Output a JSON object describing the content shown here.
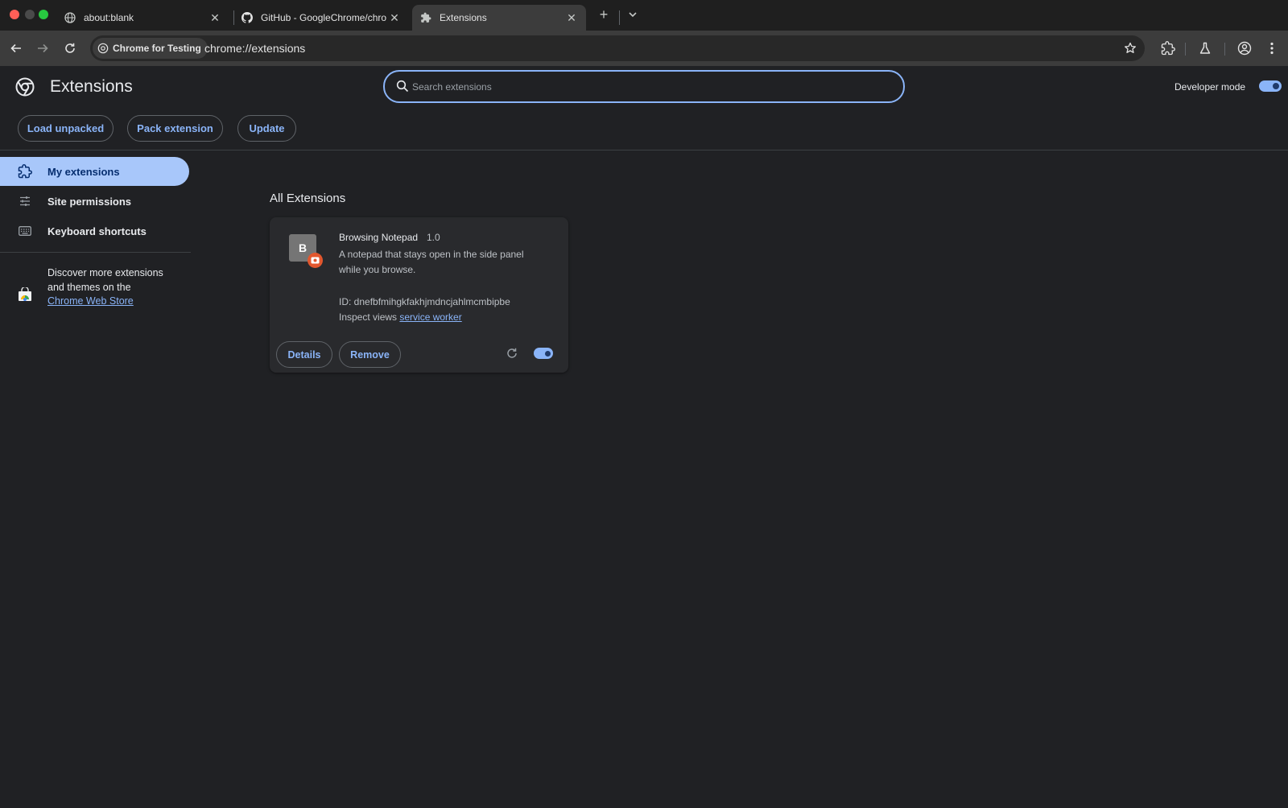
{
  "tabs": [
    {
      "title": "about:blank",
      "icon": "globe-icon",
      "active": false
    },
    {
      "title": "GitHub - GoogleChrome/chro",
      "icon": "github-icon",
      "active": false
    },
    {
      "title": "Extensions",
      "icon": "puzzle-icon",
      "active": true
    }
  ],
  "toolbar": {
    "chip_label": "Chrome for Testing",
    "url": "chrome://extensions"
  },
  "header": {
    "title": "Extensions",
    "search_placeholder": "Search extensions",
    "developer_mode_label": "Developer mode",
    "developer_mode_on": true
  },
  "actions": {
    "load_unpacked": "Load unpacked",
    "pack_extension": "Pack extension",
    "update": "Update"
  },
  "sidebar": {
    "items": [
      {
        "label": "My extensions",
        "icon": "puzzle-outline-icon",
        "active": true
      },
      {
        "label": "Site permissions",
        "icon": "sliders-icon",
        "active": false
      },
      {
        "label": "Keyboard shortcuts",
        "icon": "keyboard-icon",
        "active": false
      }
    ],
    "webstore_text_before": "Discover more extensions and themes on the ",
    "webstore_link": "Chrome Web Store"
  },
  "main": {
    "section_title": "All Extensions",
    "extension": {
      "icon_letter": "B",
      "name": "Browsing Notepad",
      "version": "1.0",
      "description": "A notepad that stays open in the side panel while you browse.",
      "id_text": "ID: dnefbfmihgkfakhjmdncjahlmcmbipbe",
      "inspect_label": "Inspect views",
      "inspect_link": "service worker",
      "details_label": "Details",
      "remove_label": "Remove",
      "enabled": true
    }
  },
  "colors": {
    "accent": "#8ab4f8",
    "active_nav": "#a8c7fa",
    "background": "#202124",
    "card": "#292a2d"
  }
}
